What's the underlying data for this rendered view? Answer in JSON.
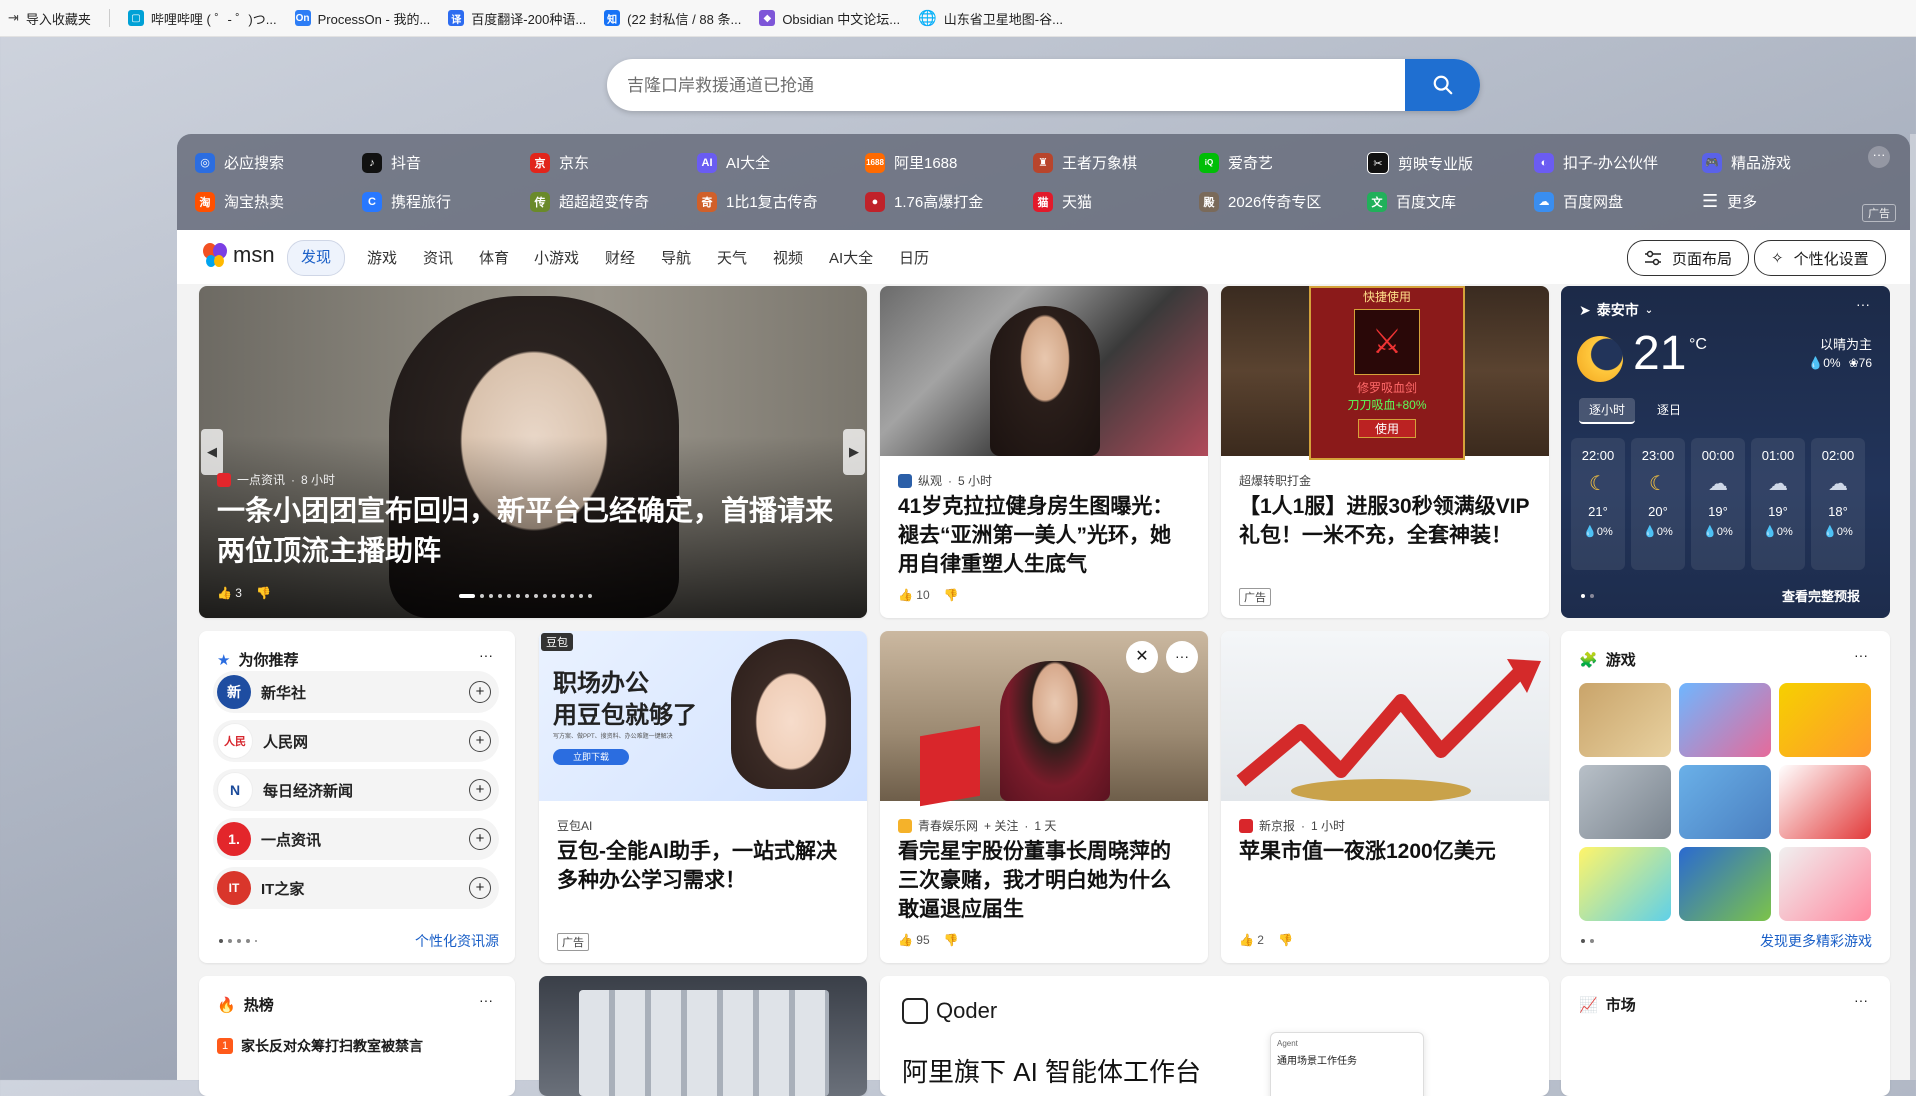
{
  "bookmarks": [
    {
      "label": "导入收藏夹",
      "color": "#666666"
    },
    {
      "label": "哔哩哔哩 ( ゜- ゜)つ...",
      "color": "#00a1d6"
    },
    {
      "label": "ProcessOn - 我的...",
      "color": "#2d7df5"
    },
    {
      "label": "百度翻译-200种语...",
      "color": "#2d6cf0"
    },
    {
      "label": "(22 封私信 / 88 条...",
      "color": "#1772f6"
    },
    {
      "label": "Obsidian 中文论坛...",
      "color": "#7e56d8"
    },
    {
      "label": "山东省卫星地图-谷...",
      "color": "#555555"
    }
  ],
  "search": {
    "placeholder": "吉隆口岸救援通道已抢通"
  },
  "quick_links": {
    "row1": [
      {
        "label": "必应搜索",
        "color": "#2b6de0"
      },
      {
        "label": "抖音",
        "color": "#111111"
      },
      {
        "label": "京东",
        "color": "#e1251b"
      },
      {
        "label": "AI大全",
        "color": "#6a5cf2"
      },
      {
        "label": "阿里1688",
        "color": "#ff6a00"
      },
      {
        "label": "王者万象棋",
        "color": "#b8452c"
      },
      {
        "label": "爱奇艺",
        "color": "#00be06"
      },
      {
        "label": "剪映专业版",
        "color": "#111111"
      },
      {
        "label": "扣子-办公伙伴",
        "color": "#6b5cf2"
      },
      {
        "label": "精品游戏",
        "color": "#5a62e8"
      }
    ],
    "row2": [
      {
        "label": "淘宝热卖",
        "color": "#ff5000"
      },
      {
        "label": "携程旅行",
        "color": "#2878ff"
      },
      {
        "label": "超超超变传奇",
        "color": "#6a8a2a"
      },
      {
        "label": "1比1复古传奇",
        "color": "#d0602a"
      },
      {
        "label": "1.76高爆打金",
        "color": "#c0222a"
      },
      {
        "label": "天猫",
        "color": "#e21a2a"
      },
      {
        "label": "2026传奇专区",
        "color": "#7a6a5a"
      },
      {
        "label": "百度文库",
        "color": "#21b05a"
      },
      {
        "label": "百度网盘",
        "color": "#3a8ef0"
      },
      {
        "label": "更多",
        "color": "#ffffff"
      }
    ],
    "ad": "广告"
  },
  "nav": {
    "brand": "msn",
    "tabs": [
      "发现",
      "游戏",
      "资讯",
      "体育",
      "小游戏",
      "财经",
      "导航",
      "天气",
      "视频",
      "AI大全",
      "日历"
    ],
    "layout_btn": "页面布局",
    "personal_btn": "个性化设置"
  },
  "hero": {
    "source": "一点资讯",
    "time": "8 小时",
    "title": "一条小团团宣布回归，新平台已经确定，首播请来两位顶流主播助阵",
    "likes": "3"
  },
  "news1": {
    "source": "纵观",
    "time": "5 小时",
    "title": "41岁克拉拉健身房生图曝光：褪去“亚洲第一美人”光环，她用自律重塑人生底气",
    "likes": "10"
  },
  "ad1": {
    "source": "超爆转职打金",
    "title": "【1人1服】进服30秒领满级VIP礼包！一米不充，全套神装！",
    "ad": "广告",
    "img_top": "快捷使用",
    "img_item": "修罗吸血剑",
    "img_stat": "刀刀吸血+80%",
    "img_btn": "使用"
  },
  "weather": {
    "city": "泰安市",
    "temp": "21",
    "unit": "°C",
    "cond": "以晴为主",
    "rain": "0%",
    "aqi": "76",
    "tab_hourly": "逐小时",
    "tab_daily": "逐日",
    "hours": [
      {
        "t": "22:00",
        "temp": "21°",
        "p": "0%"
      },
      {
        "t": "23:00",
        "temp": "20°",
        "p": "0%"
      },
      {
        "t": "00:00",
        "temp": "19°",
        "p": "0%"
      },
      {
        "t": "01:00",
        "temp": "19°",
        "p": "0%"
      },
      {
        "t": "02:00",
        "temp": "18°",
        "p": "0%"
      }
    ],
    "full": "查看完整预报"
  },
  "recommend": {
    "title": "为你推荐",
    "items": [
      {
        "name": "新华社",
        "color": "#1e4da1"
      },
      {
        "name": "人民网",
        "color": "#d7262d"
      },
      {
        "name": "每日经济新闻",
        "color": "#1a4a9a"
      },
      {
        "name": "一点资讯",
        "color": "#e3262b"
      },
      {
        "name": "IT之家",
        "color": "#d9362b"
      }
    ],
    "link": "个性化资讯源"
  },
  "doubao": {
    "badge": "豆包",
    "img_l1": "职场办公",
    "img_l2": "用豆包就够了",
    "img_sub": "写方案、做PPT、搜资料、办公难题一键解决",
    "img_btn": "立即下载",
    "source": "豆包AI",
    "title": "豆包-全能AI助手，一站式解决多种办公学习需求！",
    "ad": "广告"
  },
  "news2": {
    "source": "青春娱乐网",
    "follow": "+ 关注",
    "time": "1 天",
    "title": "看完星宇股份董事长周晓萍的三次豪赌，我才明白她为什么敢逼退应届生",
    "likes": "95"
  },
  "news3": {
    "source": "新京报",
    "time": "1 小时",
    "title": "苹果市值一夜涨1200亿美元",
    "likes": "2"
  },
  "games": {
    "title": "游戏",
    "link": "发现更多精彩游戏"
  },
  "hot": {
    "title": "热榜",
    "item1_rank": "1",
    "item1": "家长反对众筹打扫教室被禁言"
  },
  "qoder": {
    "brand": "Qoder",
    "headline": "阿里旗下 AI 智能体工作台",
    "mini1": "Agent",
    "mini2": "通用场景工作任务"
  },
  "market": {
    "title": "市场"
  }
}
